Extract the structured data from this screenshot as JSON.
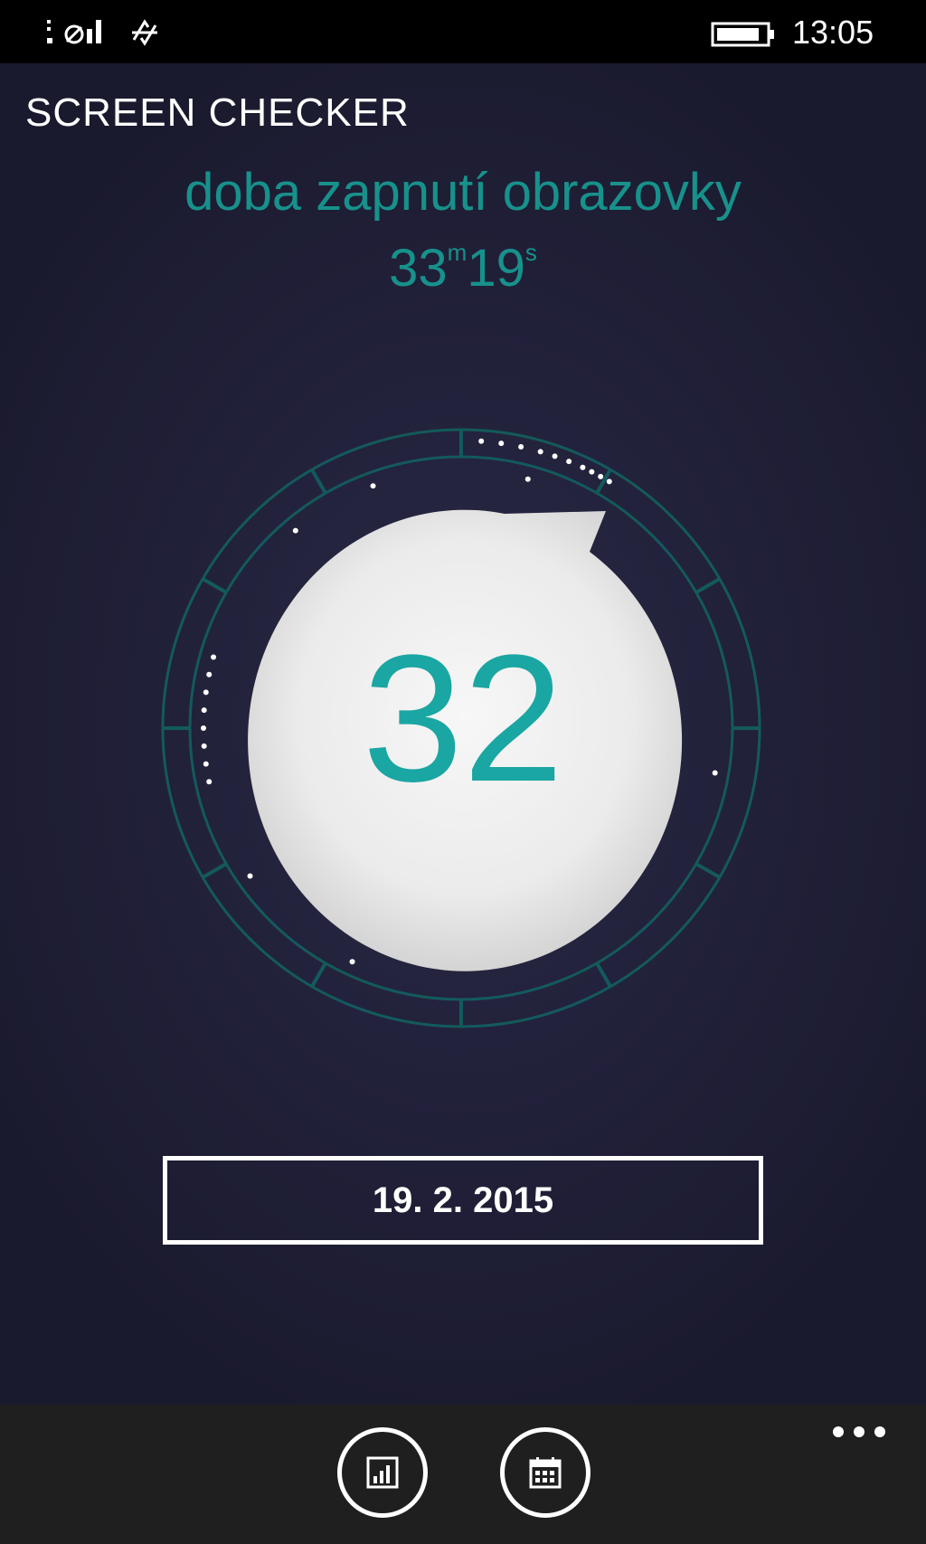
{
  "status_bar": {
    "time": "13:05",
    "icons": [
      "signal-icon",
      "sync-icon",
      "battery-icon"
    ]
  },
  "header": {
    "title": "SCREEN CHECKER",
    "subtitle": "doba zapnutí obrazovky",
    "duration": {
      "minutes": "33",
      "minutes_unit": "m",
      "seconds": "19",
      "seconds_unit": "s"
    }
  },
  "dial": {
    "value": "32"
  },
  "date_button": {
    "label": "19. 2. 2015"
  },
  "app_bar": {
    "buttons": [
      {
        "icon": "stats-chart-icon"
      },
      {
        "icon": "calendar-icon"
      }
    ],
    "more_icon": "ellipsis-icon"
  },
  "colors": {
    "accent": "#17918b",
    "background": "#1d1c33",
    "ring": "#135a5c",
    "disc": "#ebebeb",
    "appbar": "#1f1f1f"
  }
}
